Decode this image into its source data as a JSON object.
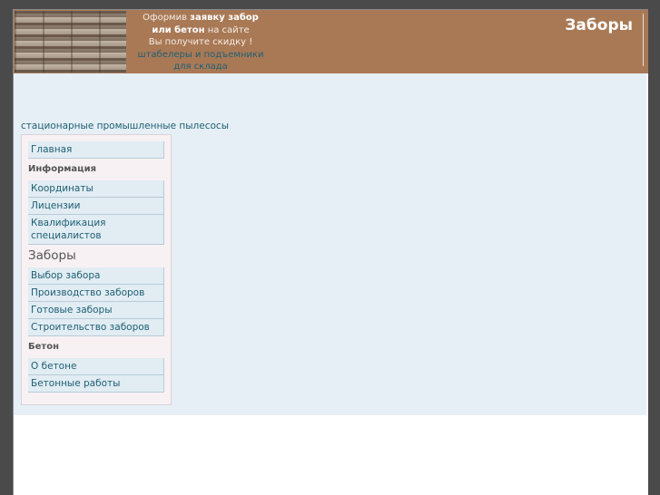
{
  "header": {
    "promo_prefix": "Оформив ",
    "promo_bold_1": "заявку забор",
    "promo_bold_2": "или бетон",
    "promo_suffix": " на сайте",
    "promo_line_3": "Вы получите скидку !",
    "promo_link_1": "штабелеры и подъемники",
    "promo_link_2": "для склада",
    "site_title": "Заборы"
  },
  "top_link": "стационарные промышленные пылесосы",
  "sidebar": {
    "home": "Главная",
    "section_info": "Информация",
    "info_items": [
      "Координаты",
      "Лицензии",
      "Квалификация специалистов"
    ],
    "section_fences": "Заборы",
    "fence_items": [
      "Выбор забора",
      "Производство заборов",
      "Готовые заборы",
      "Строительство заборов"
    ],
    "section_concrete": "Бетон",
    "concrete_items": [
      "О бетоне",
      "Бетонные работы"
    ]
  }
}
